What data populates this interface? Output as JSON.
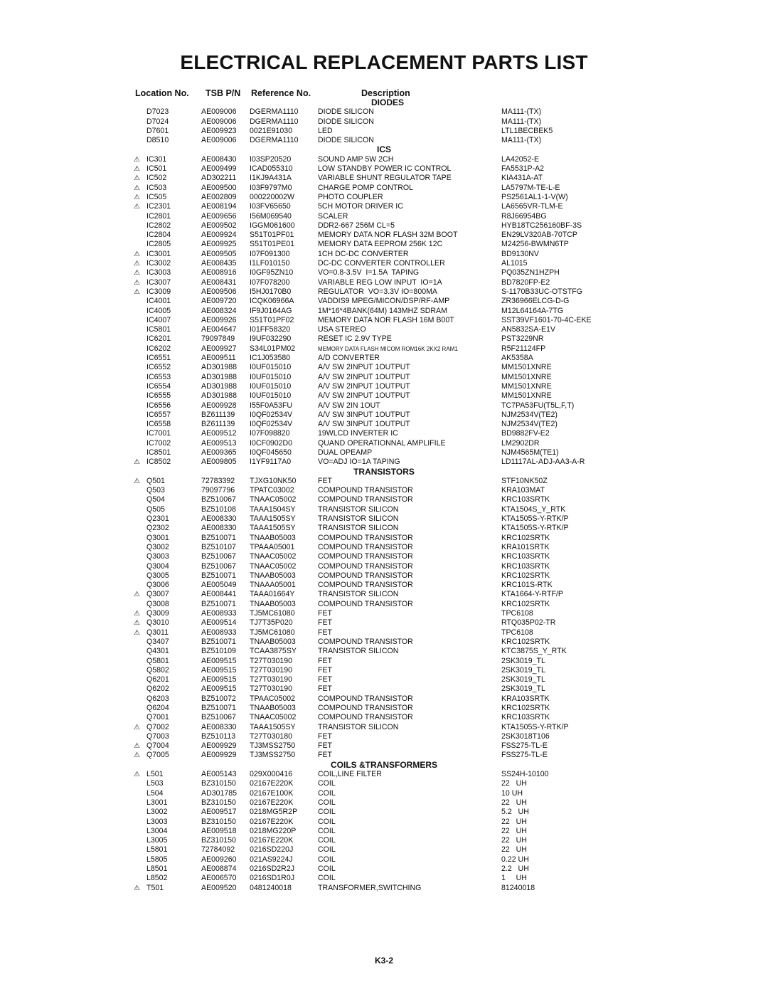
{
  "title": "ELECTRICAL REPLACEMENT PARTS LIST",
  "columns": {
    "location": "Location No.",
    "tsb": "TSB P/N",
    "reference": "Reference No.",
    "description": "Description"
  },
  "warning_symbol": "⚠",
  "sections": [
    {
      "name": "DIODES",
      "rows": [
        {
          "warn": false,
          "loc": "D7023",
          "tsb": "AE009006",
          "ref": "DGERMA1110",
          "desc": "DIODE SILICON",
          "part": "MA111-(TX)"
        },
        {
          "warn": false,
          "loc": "D7024",
          "tsb": "AE009006",
          "ref": "DGERMA1110",
          "desc": "DIODE SILICON",
          "part": "MA111-(TX)"
        },
        {
          "warn": false,
          "loc": "D7601",
          "tsb": "AE009923",
          "ref": "0021E91030",
          "desc": "LED",
          "part": "LTL1BECBEK5"
        },
        {
          "warn": false,
          "loc": "D8510",
          "tsb": "AE009006",
          "ref": "DGERMA1110",
          "desc": "DIODE SILICON",
          "part": "MA111-(TX)"
        }
      ]
    },
    {
      "name": "ICS",
      "rows": [
        {
          "warn": true,
          "loc": "IC301",
          "tsb": "AE008430",
          "ref": "I03SP20520",
          "desc": "SOUND AMP 5W 2CH",
          "part": "LA42052-E"
        },
        {
          "warn": true,
          "loc": "IC501",
          "tsb": "AE009499",
          "ref": "ICAD055310",
          "desc": "LOW STANDBY POWER IC CONTROL",
          "part": "FA5531P-A2"
        },
        {
          "warn": true,
          "loc": "IC502",
          "tsb": "AD302211",
          "ref": "I1KJ9A431A",
          "desc": "VARIABLE SHUNT REGULATOR TAPE",
          "part": "KIA431A-AT"
        },
        {
          "warn": true,
          "loc": "IC503",
          "tsb": "AE009500",
          "ref": "I03F9797M0",
          "desc": "CHARGE POMP CONTROL",
          "part": "LA5797M-TE-L-E"
        },
        {
          "warn": true,
          "loc": "IC505",
          "tsb": "AE002809",
          "ref": "000220002W",
          "desc": "PHOTO COUPLER",
          "part": "PS2561AL1-1-V(W)"
        },
        {
          "warn": true,
          "loc": "IC2301",
          "tsb": "AE008194",
          "ref": "I03FV65650",
          "desc": "5CH MOTOR DRIVER IC",
          "part": "LA6565VR-TLM-E"
        },
        {
          "warn": false,
          "loc": "IC2801",
          "tsb": "AE009656",
          "ref": "I56M069540",
          "desc": "SCALER",
          "part": "R8J66954BG"
        },
        {
          "warn": false,
          "loc": "IC2802",
          "tsb": "AE009502",
          "ref": "IGGM061600",
          "desc": "DDR2-667 256M CL=5",
          "part": "HYB18TC256160BF-3S"
        },
        {
          "warn": false,
          "loc": "IC2804",
          "tsb": "AE009924",
          "ref": "S51T01PF01",
          "desc": "MEMORY DATA NOR FLASH 32M BOOT",
          "part": "EN29LV320AB-70TCP"
        },
        {
          "warn": false,
          "loc": "IC2805",
          "tsb": "AE009925",
          "ref": "S51T01PE01",
          "desc": "MEMORY DATA EEPROM 256K 12C",
          "part": "M24256-BWMN6TP"
        },
        {
          "warn": true,
          "loc": "IC3001",
          "tsb": "AE009505",
          "ref": "I07F091300",
          "desc": "1CH DC-DC CONVERTER",
          "part": "BD9130NV"
        },
        {
          "warn": true,
          "loc": "IC3002",
          "tsb": "AE008435",
          "ref": "I1LF010150",
          "desc": "DC-DC CONVERTER CONTROLLER",
          "part": "AL1015"
        },
        {
          "warn": true,
          "loc": "IC3003",
          "tsb": "AE008916",
          "ref": "I0GF95ZN10",
          "desc": "VO=0.8-3.5V  I=1.5A  TAPING",
          "part": "PQ035ZN1HZPH"
        },
        {
          "warn": true,
          "loc": "IC3007",
          "tsb": "AE008431",
          "ref": "I07F078200",
          "desc": "VARIABLE REG LOW INPUT  IO=1A",
          "part": "BD7820FP-E2"
        },
        {
          "warn": true,
          "loc": "IC3009",
          "tsb": "AE009506",
          "ref": "I5HJ0170B0",
          "desc": "REGULATOR  VO=3.3V IO=800MA",
          "part": "S-1170B33UC-OTSTFG"
        },
        {
          "warn": false,
          "loc": "IC4001",
          "tsb": "AE009720",
          "ref": "ICQK06966A",
          "desc": "VADDIS9 MPEG/MICON/DSP/RF-AMP",
          "part": "ZR36966ELCG-D-G"
        },
        {
          "warn": false,
          "loc": "IC4005",
          "tsb": "AE008324",
          "ref": "IF9J0164AG",
          "desc": "1M*16*4BANK(64M) 143MHZ SDRAM",
          "part": "M12L64164A-7TG"
        },
        {
          "warn": false,
          "loc": "IC4007",
          "tsb": "AE009926",
          "ref": "S51T01PF02",
          "desc": "MEMORY DATA NOR FLASH 16M B00T",
          "part": "SST39VF1601-70-4C-EKE"
        },
        {
          "warn": false,
          "loc": "IC5801",
          "tsb": "AE004647",
          "ref": "I01FF58320",
          "desc": "USA STEREO",
          "part": "AN5832SA-E1V"
        },
        {
          "warn": false,
          "loc": "IC6201",
          "tsb": "79097849",
          "ref": "I9UF032290",
          "desc": "RESET IC 2.9V TYPE",
          "part": "PST3229NR"
        },
        {
          "warn": false,
          "loc": "IC6202",
          "tsb": "AE009927",
          "ref": "S34L01PM02",
          "desc": "MEMORY DATA FLASH MICOM ROM16K 2KX2 RAM1",
          "part": "R5F21124FP",
          "small": true
        },
        {
          "warn": false,
          "loc": "IC6551",
          "tsb": "AE009511",
          "ref": "IC1J053580",
          "desc": "A/D CONVERTER",
          "part": "AK5358A"
        },
        {
          "warn": false,
          "loc": "IC6552",
          "tsb": "AD301988",
          "ref": "I0UF015010",
          "desc": "A/V SW 2INPUT 1OUTPUT",
          "part": "MM1501XNRE"
        },
        {
          "warn": false,
          "loc": "IC6553",
          "tsb": "AD301988",
          "ref": "I0UF015010",
          "desc": "A/V SW 2INPUT 1OUTPUT",
          "part": "MM1501XNRE"
        },
        {
          "warn": false,
          "loc": "IC6554",
          "tsb": "AD301988",
          "ref": "I0UF015010",
          "desc": "A/V SW 2INPUT 1OUTPUT",
          "part": "MM1501XNRE"
        },
        {
          "warn": false,
          "loc": "IC6555",
          "tsb": "AD301988",
          "ref": "I0UF015010",
          "desc": "A/V SW 2INPUT 1OUTPUT",
          "part": "MM1501XNRE"
        },
        {
          "warn": false,
          "loc": "IC6556",
          "tsb": "AE009928",
          "ref": "I55F0A53FU",
          "desc": "A/V SW 2IN 1OUT",
          "part": "TC7PA53FU(T5L,F,T)"
        },
        {
          "warn": false,
          "loc": "IC6557",
          "tsb": "BZ611139",
          "ref": "I0QF02534V",
          "desc": "A/V SW 3INPUT 1OUTPUT",
          "part": "NJM2534V(TE2)"
        },
        {
          "warn": false,
          "loc": "IC6558",
          "tsb": "BZ611139",
          "ref": "I0QF02534V",
          "desc": "A/V SW 3INPUT 1OUTPUT",
          "part": "NJM2534V(TE2)"
        },
        {
          "warn": false,
          "loc": "IC7001",
          "tsb": "AE009512",
          "ref": "I07F098820",
          "desc": "19WLCD INVERTER IC",
          "part": "BD9882FV-E2"
        },
        {
          "warn": false,
          "loc": "IC7002",
          "tsb": "AE009513",
          "ref": "I0CF0902D0",
          "desc": "QUAND OPERATIONNAL AMPLIFILE",
          "part": "LM2902DR"
        },
        {
          "warn": false,
          "loc": "IC8501",
          "tsb": "AE009365",
          "ref": "I0QF045650",
          "desc": "DUAL OPEAMP",
          "part": "NJM4565M(TE1)"
        },
        {
          "warn": true,
          "loc": "IC8502",
          "tsb": "AE009805",
          "ref": "I1YF9117A0",
          "desc": "VO=ADJ IO=1A TAPING",
          "part": "LD1117AL-ADJ-AA3-A-R"
        }
      ]
    },
    {
      "name": "TRANSISTORS",
      "rows": [
        {
          "warn": true,
          "loc": "Q501",
          "tsb": "72783392",
          "ref": "TJXG10NK50",
          "desc": "FET",
          "part": "STF10NK50Z"
        },
        {
          "warn": false,
          "loc": "Q503",
          "tsb": "79097796",
          "ref": "TPATC03002",
          "desc": "COMPOUND TRANSISTOR",
          "part": "KRA103MAT"
        },
        {
          "warn": false,
          "loc": "Q504",
          "tsb": "BZ510067",
          "ref": "TNAAC05002",
          "desc": "COMPOUND TRANSISTOR",
          "part": "KRC103SRTK"
        },
        {
          "warn": false,
          "loc": "Q505",
          "tsb": "BZ510108",
          "ref": "TAAA1504SY",
          "desc": "TRANSISTOR SILICON",
          "part": "KTA1504S_Y_RTK"
        },
        {
          "warn": false,
          "loc": "Q2301",
          "tsb": "AE008330",
          "ref": "TAAA1505SY",
          "desc": "TRANSISTOR SILICON",
          "part": "KTA1505S-Y-RTK/P"
        },
        {
          "warn": false,
          "loc": "Q2302",
          "tsb": "AE008330",
          "ref": "TAAA1505SY",
          "desc": "TRANSISTOR SILICON",
          "part": "KTA1505S-Y-RTK/P"
        },
        {
          "warn": false,
          "loc": "Q3001",
          "tsb": "BZ510071",
          "ref": "TNAAB05003",
          "desc": "COMPOUND TRANSISTOR",
          "part": "KRC102SRTK"
        },
        {
          "warn": false,
          "loc": "Q3002",
          "tsb": "BZ510107",
          "ref": "TPAAA05001",
          "desc": "COMPOUND TRANSISTOR",
          "part": "KRA101SRTK"
        },
        {
          "warn": false,
          "loc": "Q3003",
          "tsb": "BZ510067",
          "ref": "TNAAC05002",
          "desc": "COMPOUND TRANSISTOR",
          "part": "KRC103SRTK"
        },
        {
          "warn": false,
          "loc": "Q3004",
          "tsb": "BZ510067",
          "ref": "TNAAC05002",
          "desc": "COMPOUND TRANSISTOR",
          "part": "KRC103SRTK"
        },
        {
          "warn": false,
          "loc": "Q3005",
          "tsb": "BZ510071",
          "ref": "TNAAB05003",
          "desc": "COMPOUND TRANSISTOR",
          "part": "KRC102SRTK"
        },
        {
          "warn": false,
          "loc": "Q3006",
          "tsb": "AE005049",
          "ref": "TNAAA05001",
          "desc": "COMPOUND TRANSISTOR",
          "part": "KRC101S-RTK"
        },
        {
          "warn": true,
          "loc": "Q3007",
          "tsb": "AE008441",
          "ref": "TAAA01664Y",
          "desc": "TRANSISTOR SILICON",
          "part": "KTA1664-Y-RTF/P"
        },
        {
          "warn": false,
          "loc": "Q3008",
          "tsb": "BZ510071",
          "ref": "TNAAB05003",
          "desc": "COMPOUND TRANSISTOR",
          "part": "KRC102SRTK"
        },
        {
          "warn": true,
          "loc": "Q3009",
          "tsb": "AE008933",
          "ref": "TJ5MC61080",
          "desc": "FET",
          "part": "TPC6108"
        },
        {
          "warn": true,
          "loc": "Q3010",
          "tsb": "AE009514",
          "ref": "TJ7T35P020",
          "desc": "FET",
          "part": "RTQ035P02-TR"
        },
        {
          "warn": true,
          "loc": "Q3011",
          "tsb": "AE008933",
          "ref": "TJ5MC61080",
          "desc": "FET",
          "part": "TPC6108"
        },
        {
          "warn": false,
          "loc": "Q3407",
          "tsb": "BZ510071",
          "ref": "TNAAB05003",
          "desc": "COMPOUND TRANSISTOR",
          "part": "KRC102SRTK"
        },
        {
          "warn": false,
          "loc": "Q4301",
          "tsb": "BZ510109",
          "ref": "TCAA3875SY",
          "desc": "TRANSISTOR SILICON",
          "part": "KTC3875S_Y_RTK"
        },
        {
          "warn": false,
          "loc": "Q5801",
          "tsb": "AE009515",
          "ref": "T27T030190",
          "desc": "FET",
          "part": "2SK3019_TL"
        },
        {
          "warn": false,
          "loc": "Q5802",
          "tsb": "AE009515",
          "ref": "T27T030190",
          "desc": "FET",
          "part": "2SK3019_TL"
        },
        {
          "warn": false,
          "loc": "Q6201",
          "tsb": "AE009515",
          "ref": "T27T030190",
          "desc": "FET",
          "part": "2SK3019_TL"
        },
        {
          "warn": false,
          "loc": "Q6202",
          "tsb": "AE009515",
          "ref": "T27T030190",
          "desc": "FET",
          "part": "2SK3019_TL"
        },
        {
          "warn": false,
          "loc": "Q6203",
          "tsb": "BZ510072",
          "ref": "TPAAC05002",
          "desc": "COMPOUND TRANSISTOR",
          "part": "KRA103SRTK"
        },
        {
          "warn": false,
          "loc": "Q6204",
          "tsb": "BZ510071",
          "ref": "TNAAB05003",
          "desc": "COMPOUND TRANSISTOR",
          "part": "KRC102SRTK"
        },
        {
          "warn": false,
          "loc": "Q7001",
          "tsb": "BZ510067",
          "ref": "TNAAC05002",
          "desc": "COMPOUND TRANSISTOR",
          "part": "KRC103SRTK"
        },
        {
          "warn": true,
          "loc": "Q7002",
          "tsb": "AE008330",
          "ref": "TAAA1505SY",
          "desc": "TRANSISTOR SILICON",
          "part": "KTA1505S-Y-RTK/P"
        },
        {
          "warn": false,
          "loc": "Q7003",
          "tsb": "BZ510113",
          "ref": "T27T030180",
          "desc": "FET",
          "part": "2SK3018T106"
        },
        {
          "warn": true,
          "loc": "Q7004",
          "tsb": "AE009929",
          "ref": "TJ3MSS2750",
          "desc": "FET",
          "part": "FSS275-TL-E"
        },
        {
          "warn": true,
          "loc": "Q7005",
          "tsb": "AE009929",
          "ref": "TJ3MSS2750",
          "desc": "FET",
          "part": "FSS275-TL-E"
        }
      ]
    },
    {
      "name": "COILS &TRANSFORMERS",
      "rows": [
        {
          "warn": true,
          "loc": "L501",
          "tsb": "AE005143",
          "ref": "029X000416",
          "desc": "COIL,LINE FILTER",
          "part": "SS24H-10100"
        },
        {
          "warn": false,
          "loc": "L503",
          "tsb": "BZ310150",
          "ref": "02167E220K",
          "desc": "COIL",
          "part": "22   UH"
        },
        {
          "warn": false,
          "loc": "L504",
          "tsb": "AD301785",
          "ref": "02167E100K",
          "desc": "COIL",
          "part": "10 UH"
        },
        {
          "warn": false,
          "loc": "L3001",
          "tsb": "BZ310150",
          "ref": "02167E220K",
          "desc": "COIL",
          "part": "22   UH"
        },
        {
          "warn": false,
          "loc": "L3002",
          "tsb": "AE009517",
          "ref": "0218MG5R2P",
          "desc": "COIL",
          "part": "5.2   UH"
        },
        {
          "warn": false,
          "loc": "L3003",
          "tsb": "BZ310150",
          "ref": "02167E220K",
          "desc": "COIL",
          "part": "22   UH"
        },
        {
          "warn": false,
          "loc": "L3004",
          "tsb": "AE009518",
          "ref": "0218MG220P",
          "desc": "COIL",
          "part": "22   UH"
        },
        {
          "warn": false,
          "loc": "L3005",
          "tsb": "BZ310150",
          "ref": "02167E220K",
          "desc": "COIL",
          "part": "22   UH"
        },
        {
          "warn": false,
          "loc": "L5801",
          "tsb": "72784092",
          "ref": "0216SD220J",
          "desc": "COIL",
          "part": "22   UH"
        },
        {
          "warn": false,
          "loc": "L5805",
          "tsb": "AE009260",
          "ref": "021AS9224J",
          "desc": "COIL",
          "part": "0.22 UH"
        },
        {
          "warn": false,
          "loc": "L8501",
          "tsb": "AE008874",
          "ref": "0216SD2R2J",
          "desc": "COIL",
          "part": "2.2   UH"
        },
        {
          "warn": false,
          "loc": "L8502",
          "tsb": "AE006570",
          "ref": "0216SD1R0J",
          "desc": "COIL",
          "part": "1     UH"
        },
        {
          "warn": true,
          "loc": "T501",
          "tsb": "AE009520",
          "ref": "0481240018",
          "desc": "TRANSFORMER,SWITCHING",
          "part": "81240018"
        }
      ]
    }
  ],
  "footer": "K3-2"
}
